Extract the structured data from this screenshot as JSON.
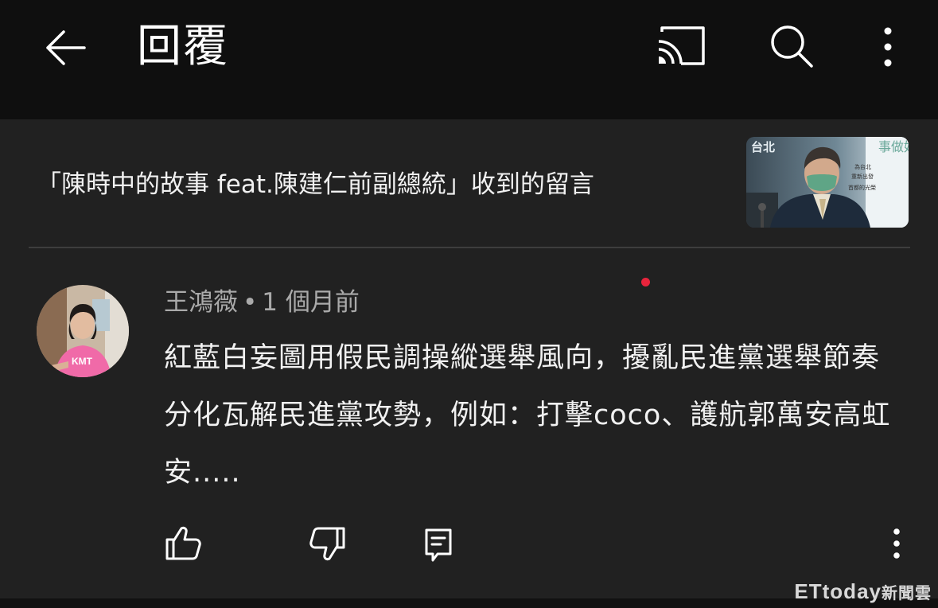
{
  "header": {
    "title": "回覆",
    "back_icon": "arrow-left-icon",
    "cast_icon": "cast-icon",
    "search_icon": "search-icon",
    "more_icon": "more-vertical-icon"
  },
  "video": {
    "title": "「陳時中的故事 feat.陳建仁前副總統」收到的留言",
    "thumbnail_text": {
      "top_left": "台北",
      "right_big": "事做好",
      "right_small_1": "為台北",
      "right_small_2": "重新出發",
      "right_small_3": "首都的光榮"
    }
  },
  "comment": {
    "author": "王鴻薇",
    "separator": "•",
    "time": "1 個月前",
    "text": "紅藍白妄圖用假民調操縱選舉風向，擾亂民進黨選舉節奏分化瓦解民進黨攻勢，例如：打擊coco、護航郭萬安高虹安.....",
    "avatar_shirt_text": "KMT",
    "actions": {
      "like_icon": "thumbs-up-icon",
      "dislike_icon": "thumbs-down-icon",
      "reply_icon": "reply-icon",
      "more_icon": "more-vertical-icon"
    }
  },
  "watermark": {
    "brand": "ETtoday",
    "suffix": "新聞雲"
  },
  "colors": {
    "topbar": "#0f0f0f",
    "background": "#212121",
    "text_primary": "#f1f1f1",
    "text_secondary": "#aaaaaa",
    "notification_dot": "#e8243c"
  }
}
